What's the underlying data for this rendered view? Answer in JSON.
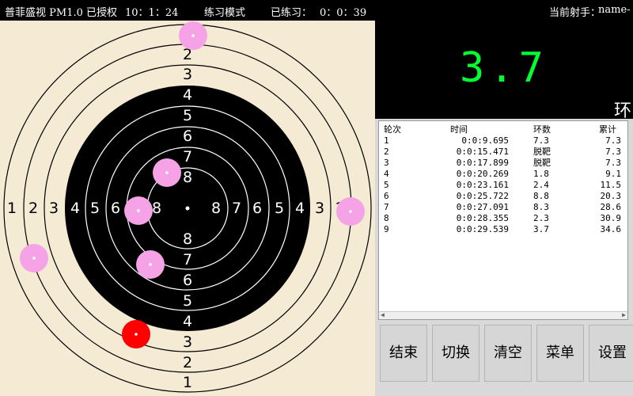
{
  "header": {
    "app_title": "普菲盛视 PM1.0 已授权",
    "clock": "10：1：24",
    "mode": "练习模式",
    "practiced_label": "已练习：",
    "practiced_time": "0：0：39",
    "shooter_label": "当前射手：",
    "shooter_name": "name-"
  },
  "target": {
    "ring_labels_vertical_top": [
      "2",
      "3",
      "4",
      "5",
      "6",
      "7",
      "8"
    ],
    "ring_labels_vertical_bottom": [
      "8",
      "7",
      "6",
      "5",
      "4",
      "3",
      "2",
      "1"
    ],
    "ring_labels_horizontal_left": [
      "1",
      "2",
      "3",
      "4",
      "5",
      "6",
      "8"
    ],
    "ring_labels_horizontal_right": [
      "8",
      "7",
      "6",
      "5",
      "4",
      "3",
      "2"
    ],
    "colors": {
      "paper": "#f5ead4",
      "black_zone": "#000000",
      "shot": "#f5a3e6",
      "last_shot": "#ff0000"
    }
  },
  "score_display": {
    "value": "3.7",
    "suffix": "环",
    "color": "#00ff33"
  },
  "shot_table": {
    "headers": [
      "轮次",
      "时间",
      "环数",
      "累计"
    ],
    "rows": [
      [
        "1",
        "0:0:9.695",
        "7.3",
        "7.3"
      ],
      [
        "2",
        "0:0:15.471",
        "脱靶",
        "7.3"
      ],
      [
        "3",
        "0:0:17.899",
        "脱靶",
        "7.3"
      ],
      [
        "4",
        "0:0:20.269",
        "1.8",
        "9.1"
      ],
      [
        "5",
        "0:0:23.161",
        "2.4",
        "11.5"
      ],
      [
        "6",
        "0:0:25.722",
        "8.8",
        "20.3"
      ],
      [
        "7",
        "0:0:27.091",
        "8.3",
        "28.6"
      ],
      [
        "8",
        "0:0:28.355",
        "2.3",
        "30.9"
      ],
      [
        "9",
        "0:0:29.539",
        "3.7",
        "34.6"
      ]
    ]
  },
  "buttons": {
    "end": "结束",
    "switch": "切换",
    "clear": "清空",
    "menu": "菜单",
    "settings": "设置"
  }
}
